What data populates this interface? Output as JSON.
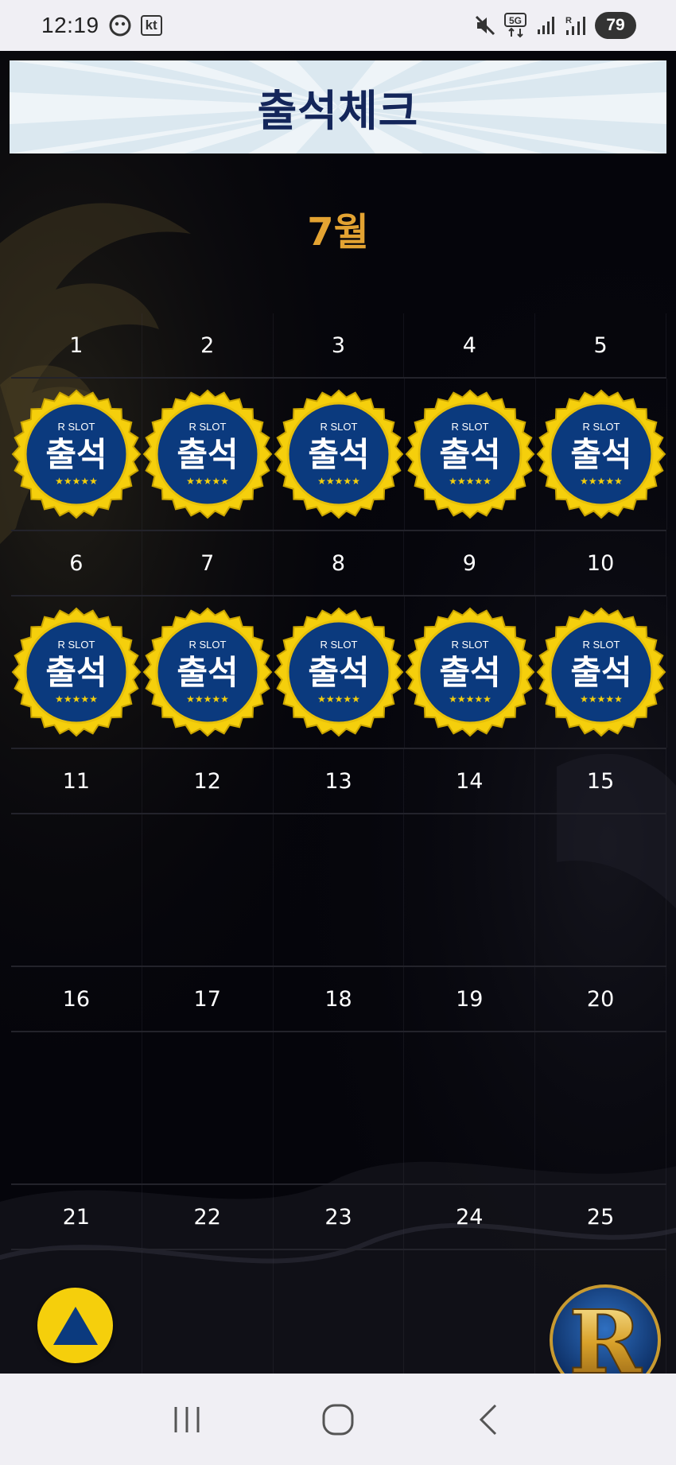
{
  "status_bar": {
    "time": "12:19",
    "carrier": "kt",
    "network": "5G",
    "battery": "79",
    "icons": [
      "face-icon",
      "kt-icon",
      "mute-icon",
      "5g-data-icon",
      "signal-icon",
      "roaming-signal-icon",
      "battery-icon"
    ]
  },
  "header": {
    "title": "출석체크"
  },
  "calendar": {
    "month": "7월",
    "weeks": [
      {
        "days": [
          "1",
          "2",
          "3",
          "4",
          "5"
        ],
        "stamped": true
      },
      {
        "days": [
          "6",
          "7",
          "8",
          "9",
          "10"
        ],
        "stamped": true
      },
      {
        "days": [
          "11",
          "12",
          "13",
          "14",
          "15"
        ],
        "stamped": false
      },
      {
        "days": [
          "16",
          "17",
          "18",
          "19",
          "20"
        ],
        "stamped": false
      },
      {
        "days": [
          "21",
          "22",
          "23",
          "24",
          "25"
        ],
        "stamped": false
      }
    ]
  },
  "stamp": {
    "brand": "R SLOT",
    "label": "출석",
    "stars": "★★★★★",
    "colors": {
      "ring": "#f5cf0c",
      "fill": "#0b3a7e",
      "text": "#ffffff"
    }
  },
  "floating": {
    "scroll_top_icon": "triangle-up-icon",
    "brand_logo_letter": "R"
  },
  "nav_bar": {
    "icons": [
      "recent-apps-icon",
      "home-icon",
      "back-icon"
    ]
  },
  "colors": {
    "accent_month": "#e3a332",
    "header_bg": "#dbe8f0",
    "header_text": "#14265a",
    "page_bg": "#05050b"
  }
}
